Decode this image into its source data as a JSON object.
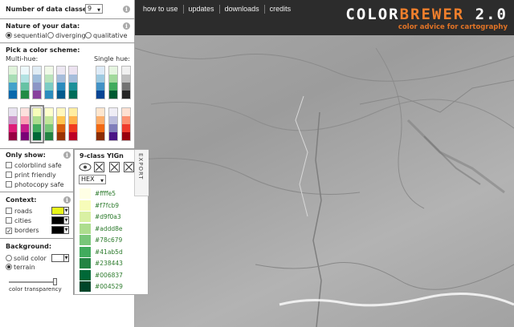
{
  "nav": [
    "how to use",
    "updates",
    "downloads",
    "credits"
  ],
  "brand": {
    "part1": "COLOR",
    "part2": "BREWER",
    "part3": " 2.0",
    "subtitle": "color advice for cartography"
  },
  "classes": {
    "label": "Number of data classes:",
    "value": "9"
  },
  "nature": {
    "label": "Nature of your data:",
    "options": [
      "sequential",
      "diverging",
      "qualitative"
    ],
    "selected": "sequential"
  },
  "scheme": {
    "label": "Pick a color scheme:",
    "multi": "Multi-hue:",
    "single": "Single hue:"
  },
  "show": {
    "label": "Only show:",
    "options": [
      "colorblind safe",
      "print friendly",
      "photocopy safe"
    ]
  },
  "context": {
    "label": "Context:",
    "options": [
      "roads",
      "cities",
      "borders"
    ],
    "checked": [
      "borders"
    ],
    "colors": [
      "#e8f51a",
      "#000000",
      "#000000"
    ]
  },
  "background": {
    "label": "Background:",
    "options": [
      "solid color",
      "terrain"
    ],
    "selected": "terrain",
    "transparency_label": "color transparency",
    "transparency": 1.0
  },
  "export": {
    "title": "9-class YlGn",
    "tab": "EXPORT",
    "format": "HEX",
    "colors": [
      "#ffffe5",
      "#f7fcb9",
      "#d9f0a3",
      "#addd8e",
      "#78c679",
      "#41ab5d",
      "#238443",
      "#006837",
      "#004529"
    ]
  },
  "icons": [
    "info-icon",
    "eye-icon",
    "close-icon",
    "dropdown-arrow-icon"
  ]
}
